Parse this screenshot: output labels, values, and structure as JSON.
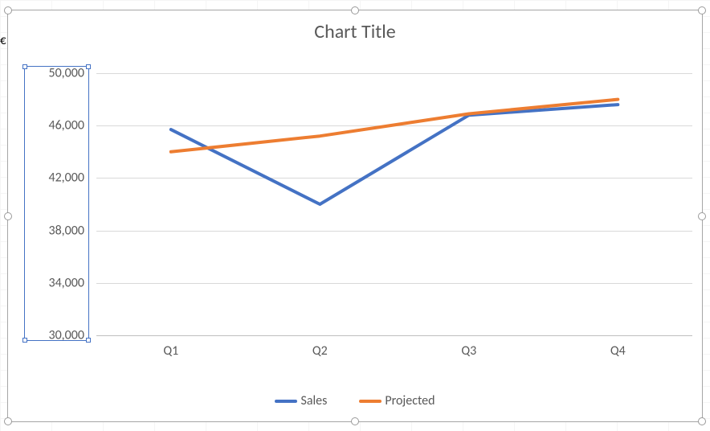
{
  "chart_data": {
    "type": "line",
    "title": "Chart Title",
    "categories": [
      "Q1",
      "Q2",
      "Q3",
      "Q4"
    ],
    "series": [
      {
        "name": "Sales",
        "values": [
          45700,
          40000,
          46800,
          47600
        ],
        "color": "#4472c4"
      },
      {
        "name": "Projected",
        "values": [
          44000,
          45200,
          46900,
          48000
        ],
        "color": "#ed7d31"
      }
    ],
    "xlabel": "",
    "ylabel": "",
    "ylim": [
      30000,
      50000
    ],
    "yticks": [
      30000,
      34000,
      38000,
      42000,
      46000,
      50000
    ],
    "grid": true,
    "legend_position": "bottom"
  },
  "yticks_fmt": [
    "30,000",
    "34,000",
    "38,000",
    "42,000",
    "46,000",
    "50,000"
  ],
  "colors": {
    "series1": "#4472c4",
    "series2": "#ed7d31",
    "grid": "#d9d9d9",
    "axis": "#bfbfbf",
    "text": "#595959",
    "selection": "#4472c4"
  }
}
